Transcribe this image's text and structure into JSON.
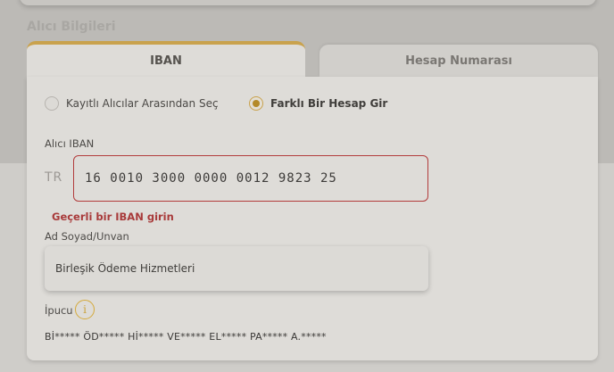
{
  "section_title": "Alıcı Bilgileri",
  "tabs": [
    {
      "label": "IBAN",
      "active": true
    },
    {
      "label": "Hesap Numarası",
      "active": false
    }
  ],
  "radio_options": [
    {
      "label": "Kayıtlı Alıcılar Arasından Seç",
      "checked": false
    },
    {
      "label": "Farklı Bir Hesap Gir",
      "checked": true
    }
  ],
  "iban_field": {
    "label": "Alıcı IBAN",
    "prefix": "TR",
    "value": "16 0010 3000 0000 0012 9823 25",
    "error": "Geçerli bir IBAN girin"
  },
  "name_field": {
    "label": "Ad Soyad/Unvan",
    "value": "Birleşik Ödeme Hizmetleri"
  },
  "hint": {
    "label": "İpucu",
    "icon": "info-icon",
    "masked_name": "Bİ***** ÖD***** Hİ***** VE***** EL***** PA***** A.*****"
  },
  "colors": {
    "accent": "#c9a24d",
    "error": "#a83a3a"
  }
}
